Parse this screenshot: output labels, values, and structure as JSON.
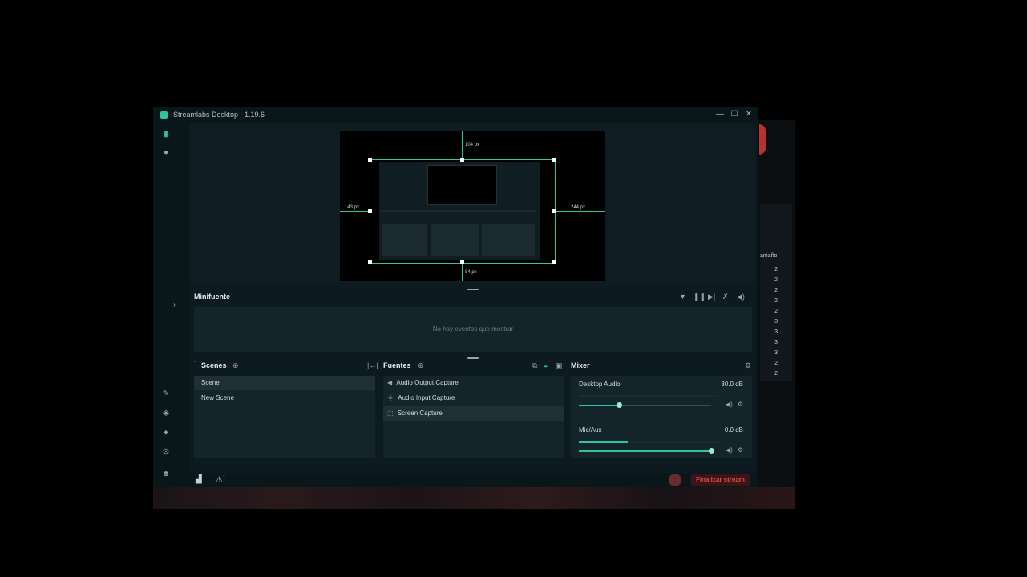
{
  "window": {
    "title": "Streamlabs Desktop - 1.19.6",
    "controls": {
      "minimize": "—",
      "maximize": "☐",
      "close": "✕"
    }
  },
  "background": {
    "partial_label": "amaño",
    "column_numbers": [
      "2",
      "2",
      "2",
      "2",
      "2",
      "3",
      "3",
      "3",
      "3",
      "2",
      "2"
    ]
  },
  "preview": {
    "dims": {
      "top": "104 px",
      "left": "143 px",
      "right": "244 px",
      "bottom": "84 px"
    }
  },
  "minifuente": {
    "title": "Minifuente",
    "empty_text": "No hay eventos que mostrar"
  },
  "scenes": {
    "title": "Scenes",
    "items": [
      {
        "label": "Scene",
        "active": true
      },
      {
        "label": "New Scene",
        "active": false
      }
    ]
  },
  "sources": {
    "title": "Fuentes",
    "items": [
      {
        "label": "Audio Output Capture",
        "icon": "speaker-icon"
      },
      {
        "label": "Audio Input Capture",
        "icon": "microphone-icon"
      },
      {
        "label": "Screen Capture",
        "icon": "screen-capture-icon",
        "active": true
      }
    ]
  },
  "mixer": {
    "title": "Mixer",
    "channels": [
      {
        "name": "Desktop Audio",
        "value": "30.0 dB",
        "meter_level": 0.0,
        "slider_level": 0.3
      },
      {
        "name": "Mic/Aux",
        "value": "0.0 dB",
        "meter_level": 0.35,
        "slider_level": 1.0
      }
    ]
  },
  "footer": {
    "stream_button": "Finalizar stream",
    "alert_count": "1"
  },
  "colors": {
    "accent": "#31c3a2",
    "background": "#09161a",
    "panel": "#13242a",
    "stream_red": "#e04a4a"
  }
}
